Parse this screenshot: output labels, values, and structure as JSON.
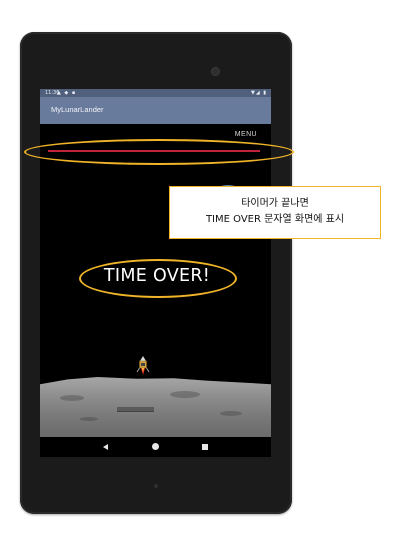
{
  "statusbar": {
    "time": "11:36",
    "left_icons": "▲ ◆ ▪",
    "right_icons": "▼◢ ▮"
  },
  "app": {
    "title": "MyLunarLander",
    "menu_label": "MENU"
  },
  "game": {
    "message": "TIME OVER!"
  },
  "annotation": {
    "line1": "타이머가 끝나면",
    "line2": "TIME OVER 문자열 화면에 표시"
  },
  "nav": {
    "back_icon": "back-triangle",
    "home_icon": "home-circle",
    "recents_icon": "recents-square"
  },
  "colors": {
    "highlight": "#f0b429",
    "fuel_bar": "#c0233a",
    "app_bar": "#687b9c",
    "status_bar": "#50607c"
  }
}
